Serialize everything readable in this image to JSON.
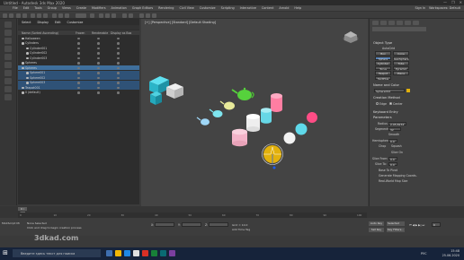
{
  "app": {
    "title": "Untitled - Autodesk 3ds Max 2020",
    "window_buttons": [
      "—",
      "❐",
      "✕"
    ]
  },
  "menubar": {
    "items": [
      "File",
      "Edit",
      "Tools",
      "Group",
      "Views",
      "Create",
      "Modifiers",
      "Animation",
      "Graph Editors",
      "Rendering",
      "Civil View",
      "Customize",
      "Scripting",
      "Interactive",
      "Content",
      "Arnold",
      "Help"
    ],
    "right": [
      "Sign In",
      "Workspaces: Default"
    ]
  },
  "explorer": {
    "tabs": [
      "Select",
      "Display",
      "Edit",
      "Customize"
    ],
    "headers": [
      "Name (Sorted Ascending)",
      "Frozen",
      "Renderable",
      "Display as Box"
    ],
    "rows": [
      {
        "name": "Halloween",
        "indent": 3,
        "state": "normal"
      },
      {
        "name": "Cylinders",
        "indent": 3,
        "state": "normal"
      },
      {
        "name": "Cylinder001",
        "indent": 8,
        "state": "normal"
      },
      {
        "name": "Cylinder002",
        "indent": 8,
        "state": "normal"
      },
      {
        "name": "Cylinder003",
        "indent": 8,
        "state": "normal"
      },
      {
        "name": "Spheres",
        "indent": 3,
        "state": "normal"
      },
      {
        "name": "Spheres",
        "indent": 3,
        "state": "selected"
      },
      {
        "name": "Sphere001",
        "indent": 8,
        "state": "selected2"
      },
      {
        "name": "Sphere002",
        "indent": 8,
        "state": "selected2"
      },
      {
        "name": "Sphere003",
        "indent": 8,
        "state": "selected2"
      },
      {
        "name": "Teapot001",
        "indent": 3,
        "state": "selected2"
      },
      {
        "name": "0 (default)",
        "indent": 3,
        "state": "normal"
      }
    ],
    "footer": {
      "layer": "Layer Explorer",
      "selection_set": "Selection Set:"
    }
  },
  "viewport": {
    "label": "[+] [Perspective] [Standard] [Default Shading]"
  },
  "command_panel": {
    "section_object_type": "Object Type",
    "autogrid": "AutoGrid",
    "buttons": [
      "Box",
      "Cone",
      "Sphere",
      "GeoSphere",
      "Cylinder",
      "Tube",
      "Torus",
      "Pyramid",
      "Teapot",
      "Plane",
      "TextPlus"
    ],
    "section_name": "Name and Color",
    "name_value": "Sphere012",
    "section_creation": "Creation Method",
    "creation_options": [
      "Edge",
      "Center"
    ],
    "section_keyboard": "Keyboard Entry",
    "section_params": "Parameters",
    "radius_label": "Radius:",
    "radius_value": "2.95,8234 t",
    "segments_label": "Segments:",
    "segments_value": "32",
    "smooth_label": "Smooth",
    "hemi_label": "Hemisphere:",
    "hemi_value": "0.0",
    "chop_label": "Chop",
    "squash_label": "Squash",
    "slice_on": "Slice On",
    "slice_from_label": "Slice From:",
    "slice_from_value": "0.0",
    "slice_to_label": "Slice To:",
    "slice_to_value": "0.0",
    "base_pivot": "Base To Pivot",
    "gen_map": "Generate Mapping Coords.",
    "real_world": "Real-World Map Size",
    "accent": "#5680b3"
  },
  "timeline": {
    "slider": "0 / 100",
    "ticks": [
      "0",
      "10",
      "20",
      "30",
      "40",
      "50",
      "60",
      "70",
      "80",
      "90",
      "100"
    ]
  },
  "status": {
    "selected": "None Selected",
    "prompt": "Click and drag to begin creation process",
    "script": "MAXScript Mi",
    "x": "X:",
    "y": "Y:",
    "z": "Z:",
    "grid": "Grid = 10.0",
    "addtime": "Add Time Tag",
    "autokey": "Auto Key",
    "selected_dd": "Selected",
    "setkey": "Set Key",
    "keyfilters": "Key Filters...",
    "frame": "0"
  },
  "taskbar": {
    "search": "Введите здесь текст для поиска",
    "time": "15:48",
    "date": "25.06.2020",
    "lang": "РУС"
  },
  "watermark": "3dkad.com"
}
